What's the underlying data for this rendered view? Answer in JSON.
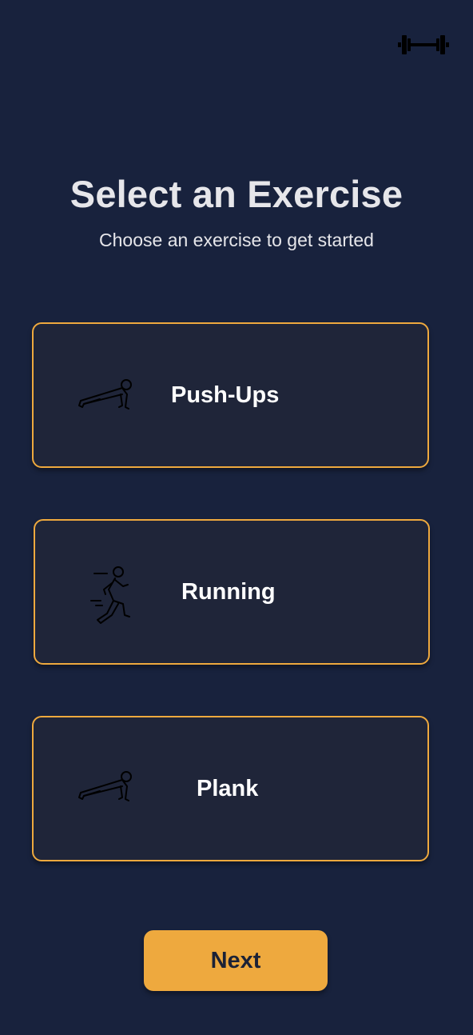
{
  "header": {
    "icon": "dumbbell-icon",
    "title": "Select an Exercise",
    "subtitle": "Choose an exercise to get started"
  },
  "exercises": [
    {
      "label": "Push-Ups",
      "icon": "push-up-icon"
    },
    {
      "label": "Running",
      "icon": "running-icon"
    },
    {
      "label": "Plank",
      "icon": "plank-icon"
    }
  ],
  "footer": {
    "next_label": "Next"
  },
  "colors": {
    "background": "#18223d",
    "card_background": "#1f2539",
    "accent": "#eea93e",
    "text": "#ffffff",
    "button_text": "#1c2236"
  }
}
